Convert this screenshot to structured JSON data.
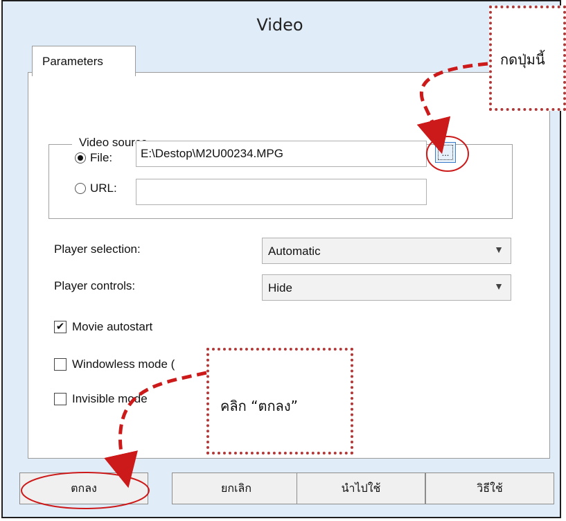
{
  "window": {
    "title": "Video"
  },
  "tabs": [
    {
      "label": "Parameters"
    }
  ],
  "video_source": {
    "label": "Video source",
    "file_label": "File:",
    "file_value": "E:\\Destop\\M2U00234.MPG",
    "url_label": "URL:",
    "url_value": "",
    "browse_label": "...",
    "selected": "File"
  },
  "player_selection": {
    "label": "Player selection:",
    "value": "Automatic"
  },
  "player_controls": {
    "label": "Player controls:",
    "value": "Hide"
  },
  "options": [
    {
      "label": "Movie autostart",
      "checked": true
    },
    {
      "label": "Windowless mode (",
      "checked": false
    },
    {
      "label": "Invisible mode",
      "checked": false
    }
  ],
  "buttons": {
    "ok": "ตกลง",
    "cancel": "ยกเลิก",
    "apply": "นำไปใช้",
    "help": "วิธีใช้"
  },
  "annotations": {
    "press_this_button": "กดปุ่มนี้",
    "click_ok": "คลิก “ตกลง”"
  },
  "colors": {
    "dialog_bg": "#e0ecf8",
    "annotation": "#cc1a1a",
    "callout_border": "#b03a3a"
  }
}
